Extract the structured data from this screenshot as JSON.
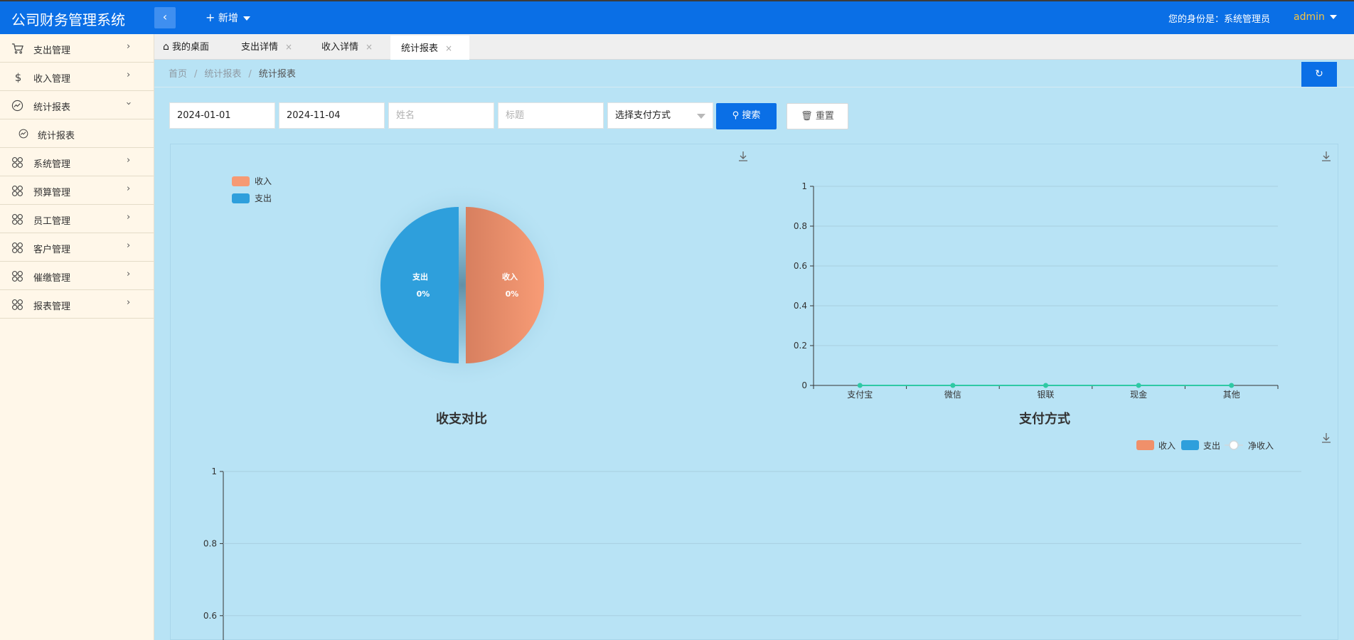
{
  "header": {
    "brand": "公司财务管理系统",
    "add_label": "新增",
    "identity": "您的身份是：系统管理员",
    "user": "admin"
  },
  "sidebar": {
    "items": [
      {
        "label": "支出管理",
        "icon": "cart-icon"
      },
      {
        "label": "收入管理",
        "icon": "dollar-icon"
      },
      {
        "label": "统计报表",
        "icon": "chart-circle-icon",
        "expanded": true
      },
      {
        "label": "系统管理",
        "icon": "grid-icon"
      },
      {
        "label": "预算管理",
        "icon": "grid-icon"
      },
      {
        "label": "员工管理",
        "icon": "grid-icon"
      },
      {
        "label": "客户管理",
        "icon": "grid-icon"
      },
      {
        "label": "催缴管理",
        "icon": "grid-icon"
      },
      {
        "label": "报表管理",
        "icon": "grid-icon"
      }
    ],
    "subitem": {
      "label": "统计报表"
    }
  },
  "tabs": [
    {
      "label": "我的桌面",
      "icon": "home-icon"
    },
    {
      "label": "支出详情",
      "close": "×"
    },
    {
      "label": "收入详情",
      "close": "×"
    },
    {
      "label": "统计报表",
      "close": "×",
      "active": true
    }
  ],
  "breadcrumb": {
    "home": "首页",
    "parent": "统计报表",
    "current": "统计报表",
    "sep": "/"
  },
  "filters": {
    "start_date": "2024-01-01",
    "end_date": "2024-11-04",
    "name_placeholder": "姓名",
    "title_placeholder": "标题",
    "payment_select": "选择支付方式",
    "search_label": "搜索",
    "reset_label": "重置"
  },
  "chart_data": [
    {
      "type": "pie",
      "title": "收支对比",
      "legend": [
        "收入",
        "支出"
      ],
      "slices": [
        {
          "name": "收入",
          "value": 0,
          "label": "0%",
          "color": "#f69a74"
        },
        {
          "name": "支出",
          "value": 0,
          "label": "0%",
          "color": "#2e9fdc"
        }
      ]
    },
    {
      "type": "line",
      "title": "支付方式",
      "categories": [
        "支付宝",
        "微信",
        "银联",
        "现金",
        "其他"
      ],
      "series": [
        {
          "values": [
            0,
            0,
            0,
            0,
            0
          ],
          "color": "#2fc9a4"
        }
      ],
      "yticks": [
        "0",
        "0.2",
        "0.4",
        "0.6",
        "0.8",
        "1"
      ],
      "ylim": [
        0,
        1
      ]
    },
    {
      "type": "bar",
      "legend": [
        "收入",
        "支出",
        "净收入"
      ],
      "series": [
        {
          "name": "收入",
          "color": "#f0906a"
        },
        {
          "name": "支出",
          "color": "#2e9fdc"
        },
        {
          "name": "净收入",
          "color": "#ffffff"
        }
      ],
      "yticks_visible": [
        "1",
        "0.8",
        "0.6"
      ],
      "ylim": [
        0,
        1
      ]
    }
  ]
}
